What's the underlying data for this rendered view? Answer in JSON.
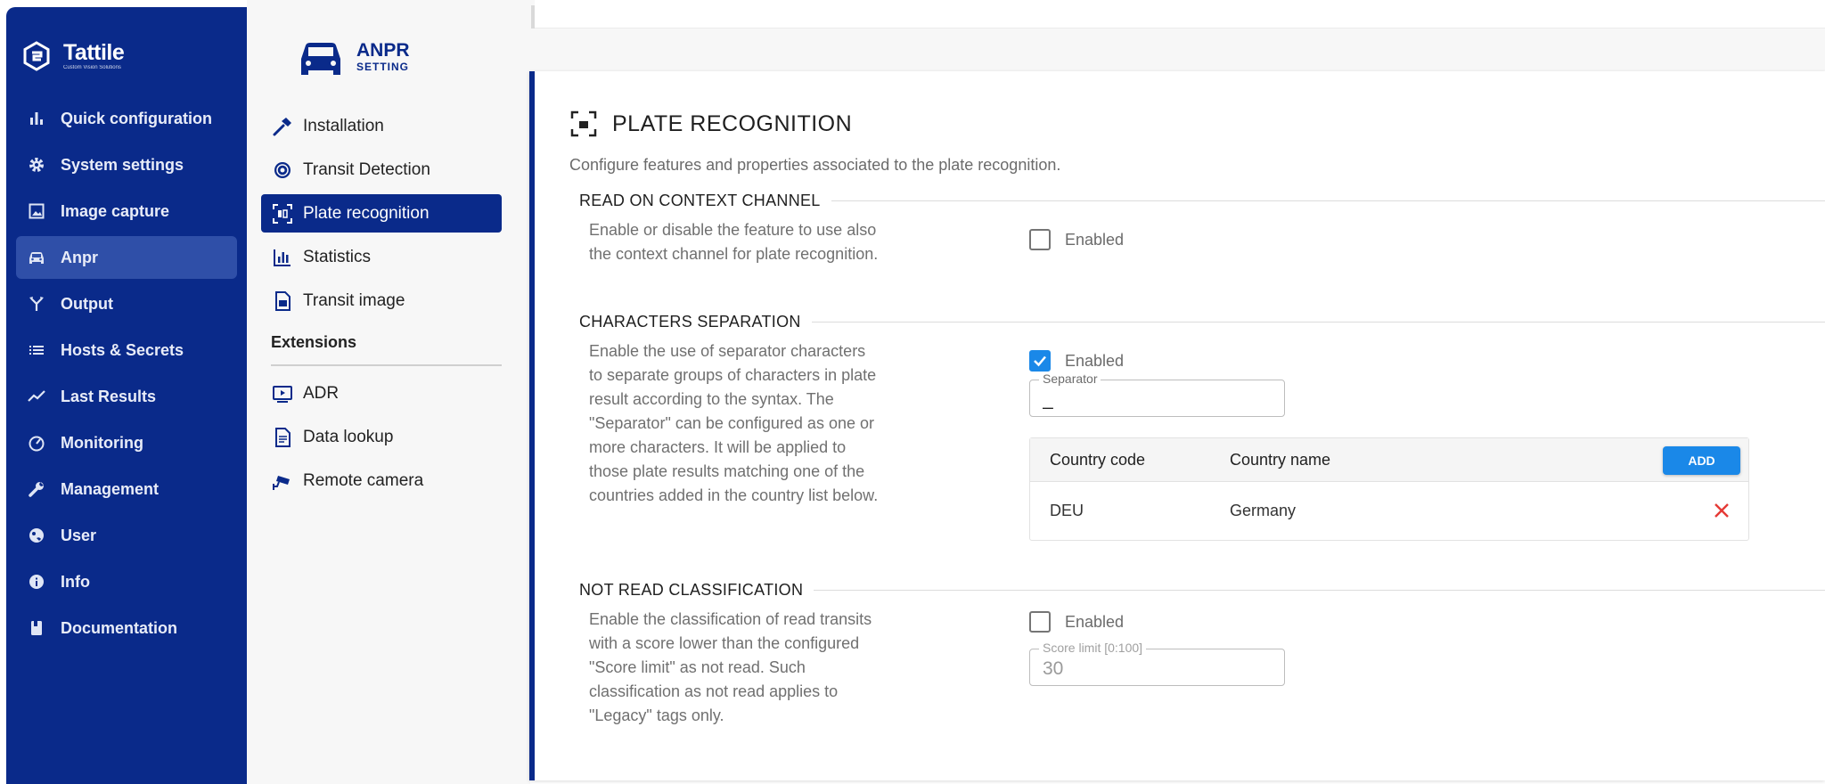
{
  "brand": {
    "name": "Tattile",
    "tagline": "Custom Vision Solutions"
  },
  "sidebar": {
    "items": [
      {
        "label": "Quick configuration",
        "icon": "bar-chart-icon"
      },
      {
        "label": "System settings",
        "icon": "gear-icon"
      },
      {
        "label": "Image capture",
        "icon": "image-icon"
      },
      {
        "label": "Anpr",
        "icon": "car-icon",
        "active": true
      },
      {
        "label": "Output",
        "icon": "fork-icon"
      },
      {
        "label": "Hosts & Secrets",
        "icon": "list-icon"
      },
      {
        "label": "Last Results",
        "icon": "trend-icon"
      },
      {
        "label": "Monitoring",
        "icon": "gauge-icon"
      },
      {
        "label": "Management",
        "icon": "wrench-icon"
      },
      {
        "label": "User",
        "icon": "globe-user-icon"
      },
      {
        "label": "Info",
        "icon": "info-icon"
      },
      {
        "label": "Documentation",
        "icon": "book-icon"
      }
    ]
  },
  "submenu": {
    "title": "ANPR",
    "subtitle": "SETTING",
    "items": [
      {
        "label": "Installation",
        "icon": "hammer-icon"
      },
      {
        "label": "Transit Detection",
        "icon": "target-icon"
      },
      {
        "label": "Plate recognition",
        "icon": "plate-scan-icon",
        "active": true
      },
      {
        "label": "Statistics",
        "icon": "statistics-icon"
      },
      {
        "label": "Transit image",
        "icon": "document-icon"
      }
    ],
    "extensions_label": "Extensions",
    "extensions": [
      {
        "label": "ADR",
        "icon": "video-icon"
      },
      {
        "label": "Data lookup",
        "icon": "file-text-icon"
      },
      {
        "label": "Remote camera",
        "icon": "camera-icon"
      }
    ]
  },
  "panel": {
    "title": "PLATE RECOGNITION",
    "description": "Configure features and properties associated to the plate recognition.",
    "sections": {
      "context": {
        "title": "READ ON CONTEXT CHANNEL",
        "description": "Enable or disable the feature to use also the context channel for plate recognition.",
        "checkbox_label": "Enabled",
        "checked": false
      },
      "separation": {
        "title": "CHARACTERS SEPARATION",
        "description": "Enable the use of separator characters to separate groups of characters in plate result according to the syntax. The \"Separator\" can be configured as one or more characters. It will be applied to those plate results matching one of the countries added in the country list below.",
        "checkbox_label": "Enabled",
        "checked": true,
        "separator_label": "Separator",
        "separator_value": "_",
        "table": {
          "headers": [
            "Country code",
            "Country name"
          ],
          "add_label": "ADD",
          "rows": [
            {
              "code": "DEU",
              "name": "Germany"
            }
          ]
        }
      },
      "not_read": {
        "title": "NOT READ CLASSIFICATION",
        "description": "Enable the classification of read transits with a score lower than the configured \"Score limit\" as not read. Such classification as not read applies to \"Legacy\" tags only.",
        "checkbox_label": "Enabled",
        "checked": false,
        "score_label": "Score limit [0:100]",
        "score_value": "30"
      }
    }
  },
  "colors": {
    "primary": "#0a2a8a",
    "accent": "#1a88e8",
    "danger": "#e53935"
  }
}
